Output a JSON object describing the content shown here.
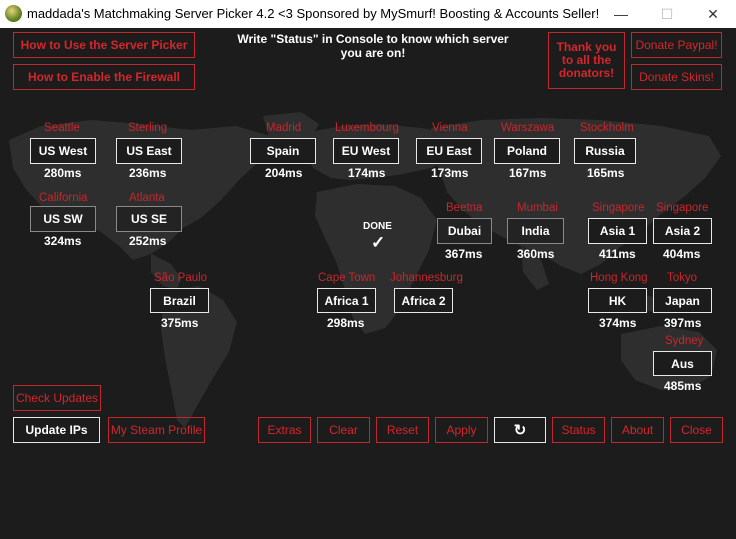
{
  "window": {
    "title": "maddada's Matchmaking Server Picker 4.2 <3 Sponsored by MySmurf! Boosting & Accounts Seller!",
    "min_glyph": "—",
    "max_glyph": "☐",
    "close_glyph": "✕"
  },
  "header": {
    "howto_picker": "How to Use the Server Picker",
    "howto_firewall": "How to Enable the Firewall",
    "notice": "Write \"Status\" in Console to know which server you are on!",
    "thanks": "Thank you to all the donators!",
    "donate_paypal": "Donate Paypal!",
    "donate_skins": "Donate Skins!"
  },
  "status": {
    "done": "DONE",
    "check": "✓"
  },
  "servers": [
    {
      "city": "Seattle",
      "label": "US West",
      "ping": "280ms"
    },
    {
      "city": "Sterling",
      "label": "US East",
      "ping": "236ms"
    },
    {
      "city": "California",
      "label": "US SW",
      "ping": "324ms"
    },
    {
      "city": "Atlanta",
      "label": "US SE",
      "ping": "252ms"
    },
    {
      "city": "Madrid",
      "label": "Spain",
      "ping": "204ms"
    },
    {
      "city": "Luxembourg",
      "label": "EU West",
      "ping": "174ms"
    },
    {
      "city": "Vienna",
      "label": "EU East",
      "ping": "173ms"
    },
    {
      "city": "Warszawa",
      "label": "Poland",
      "ping": "167ms"
    },
    {
      "city": "Stockholm",
      "label": "Russia",
      "ping": "165ms"
    },
    {
      "city": "Beetna",
      "label": "Dubai",
      "ping": "367ms"
    },
    {
      "city": "Mumbai",
      "label": "India",
      "ping": "360ms"
    },
    {
      "city": "Singapore",
      "label": "Asia 1",
      "ping": "411ms"
    },
    {
      "city": "Singapore",
      "label": "Asia 2",
      "ping": "404ms"
    },
    {
      "city": "São Paulo",
      "label": "Brazil",
      "ping": "375ms"
    },
    {
      "city": "Cape Town",
      "label": "Africa 1",
      "ping": "298ms"
    },
    {
      "city": "Johannesburg",
      "label": "Africa 2",
      "ping": ""
    },
    {
      "city": "Hong Kong",
      "label": "HK",
      "ping": "374ms"
    },
    {
      "city": "Tokyo",
      "label": "Japan",
      "ping": "397ms"
    },
    {
      "city": "Sydney",
      "label": "Aus",
      "ping": "485ms"
    }
  ],
  "footer": {
    "check_updates": "Check Updates",
    "update_ips": "Update IPs",
    "steam_profile": "My Steam Profile",
    "extras": "Extras",
    "clear": "Clear",
    "reset": "Reset",
    "apply": "Apply",
    "refresh_icon": "↻",
    "status": "Status",
    "about": "About",
    "close": "Close"
  },
  "colors": {
    "accent_red": "#c9262b",
    "background": "#1c1c1c",
    "text_white": "#ffffff"
  }
}
